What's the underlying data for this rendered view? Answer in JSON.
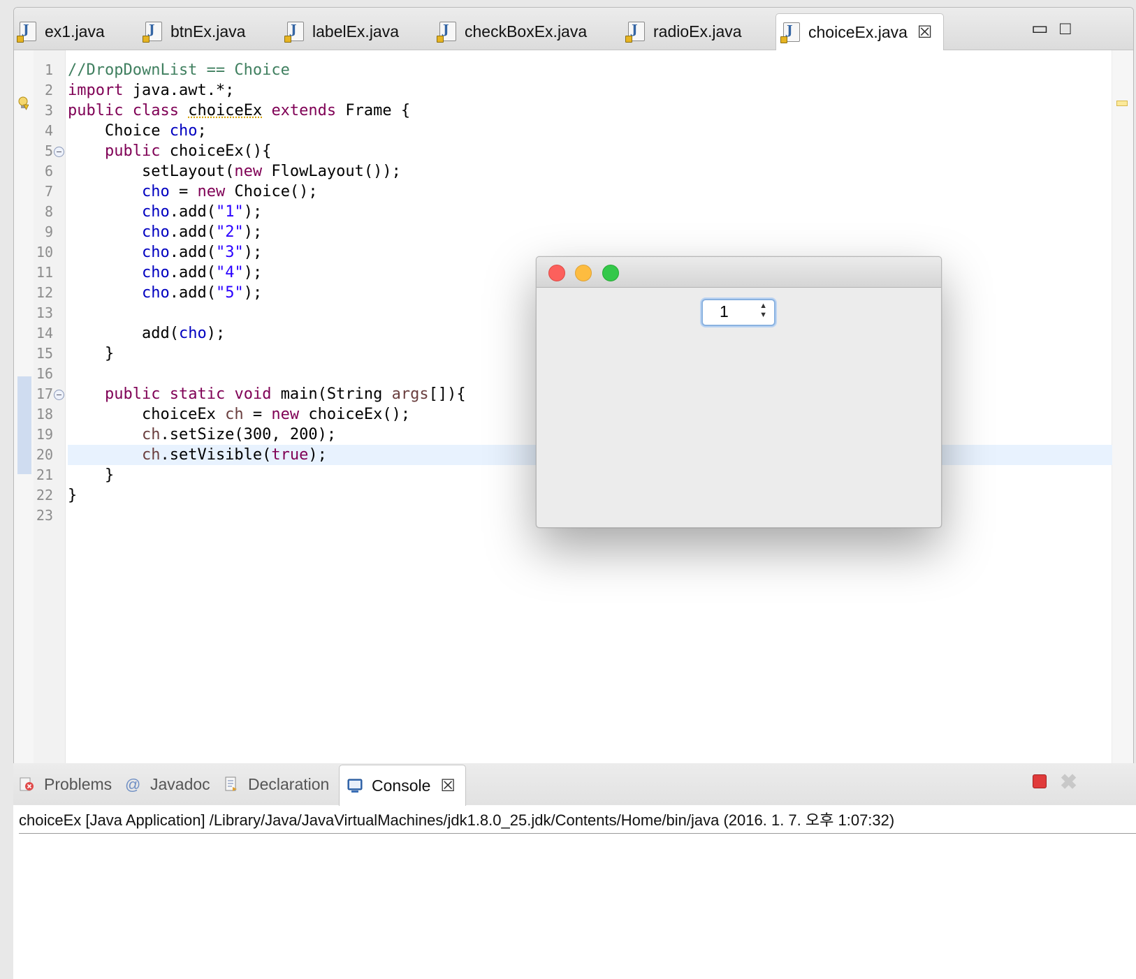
{
  "editor": {
    "tabs": [
      {
        "label": "ex1.java",
        "active": false
      },
      {
        "label": "btnEx.java",
        "active": false
      },
      {
        "label": "labelEx.java",
        "active": false
      },
      {
        "label": "checkBoxEx.java",
        "active": false
      },
      {
        "label": "radioEx.java",
        "active": false
      },
      {
        "label": "choiceEx.java",
        "active": true
      }
    ],
    "tab_close_icon": "close-icon",
    "minimize_icon": "minimize-icon",
    "maximize_icon": "maximize-icon",
    "line_numbers": [
      "1",
      "2",
      "3",
      "4",
      "5",
      "6",
      "7",
      "8",
      "9",
      "10",
      "11",
      "12",
      "13",
      "14",
      "15",
      "16",
      "17",
      "18",
      "19",
      "20",
      "21",
      "22",
      "23"
    ],
    "current_line": "20"
  },
  "awt_window": {
    "choice_value": "1"
  },
  "bottom_panel": {
    "tabs": {
      "problems": "Problems",
      "javadoc": "Javadoc",
      "declaration": "Declaration",
      "console": "Console"
    },
    "console_header": "choiceEx [Java Application] /Library/Java/JavaVirtualMachines/jdk1.8.0_25.jdk/Contents/Home/bin/java (2016. 1. 7. 오후 1:07:32)"
  },
  "colors": {
    "keyword": "#7f0055",
    "field": "#0000c0",
    "string": "#2a00ff",
    "comment": "#3f7f5f",
    "current_line_bg": "#e8f2fe"
  }
}
